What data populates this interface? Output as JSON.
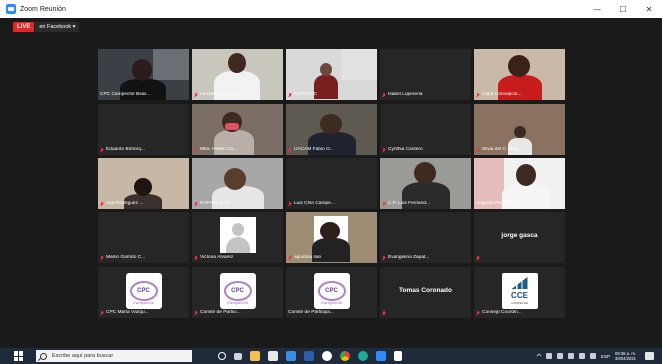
{
  "window": {
    "title": "Zoom Reunión",
    "controls": [
      "—",
      "☐",
      "✕"
    ]
  },
  "live": {
    "badge": "LIVE",
    "destination": "en Facebook ▾"
  },
  "tiles": [
    {
      "name": "CPC Campeche Beat...",
      "muted": false,
      "kind": "video",
      "active": true
    },
    {
      "name": "Leonardo de Jes...",
      "muted": true,
      "kind": "video"
    },
    {
      "name": "COPAPEC",
      "muted": true,
      "kind": "video"
    },
    {
      "name": "Isabel Loperena",
      "muted": true,
      "kind": "blank"
    },
    {
      "name": "Clara Concepció...",
      "muted": true,
      "kind": "video"
    },
    {
      "name": "Eduardo Bohórq...",
      "muted": true,
      "kind": "blank"
    },
    {
      "name": "Mtra. Hellen Ca...",
      "muted": true,
      "kind": "video"
    },
    {
      "name": "UACAM Fabio O...",
      "muted": true,
      "kind": "video"
    },
    {
      "name": "Cynthia Cantero",
      "muted": true,
      "kind": "blank"
    },
    {
      "name": "Silvia del C. Mag...",
      "muted": true,
      "kind": "video"
    },
    {
      "name": "Ana Rodríguez ...",
      "muted": true,
      "kind": "video"
    },
    {
      "name": "RAFAEL RUZ",
      "muted": true,
      "kind": "video"
    },
    {
      "name": "Luis Chin Campe...",
      "muted": true,
      "kind": "blank"
    },
    {
      "name": "C.P. Luis Fernánd...",
      "muted": true,
      "kind": "video"
    },
    {
      "name": "Augusto Peña Espe...",
      "muted": false,
      "kind": "video"
    },
    {
      "name": "Marlin Garrido C...",
      "muted": true,
      "kind": "blank"
    },
    {
      "name": "Victoria Álvarez",
      "muted": true,
      "kind": "avatar"
    },
    {
      "name": "agustina san",
      "muted": true,
      "kind": "video"
    },
    {
      "name": "Evangelina Zapat...",
      "muted": true,
      "kind": "blank"
    },
    {
      "name": "",
      "muted": true,
      "kind": "text",
      "big": "jorge gasca"
    },
    {
      "name": "CPC María Vázqu...",
      "muted": true,
      "kind": "cpc"
    },
    {
      "name": "Comité de Partici...",
      "muted": true,
      "kind": "cpc"
    },
    {
      "name": "Comité de Participa...",
      "muted": false,
      "kind": "cpc"
    },
    {
      "name": "",
      "muted": true,
      "kind": "text",
      "big": "Tomas Coronado"
    },
    {
      "name": "Consejo Coordin...",
      "muted": true,
      "kind": "cce"
    }
  ],
  "logos": {
    "cpc": "CPC",
    "cpc_script": "Campeche",
    "cce": "CCE",
    "cce_sub": "CAMPECHE"
  },
  "taskbar": {
    "search_placeholder": "Escribe aquí para buscar",
    "lang": "ESP",
    "time": "09:38 a. m.",
    "date": "30/04/2021"
  },
  "colors": {
    "active_border": "#c6e04a",
    "live_red": "#e02828",
    "taskbar": "#1f2a3a"
  }
}
